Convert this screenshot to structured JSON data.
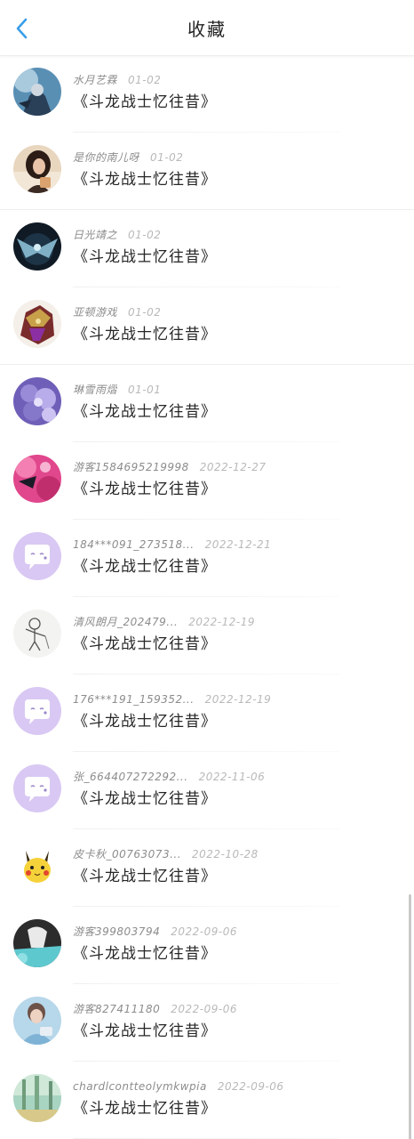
{
  "header": {
    "title": "收藏",
    "back_icon": "chevron-left-icon",
    "accent_color": "#3a9ee8"
  },
  "items": [
    {
      "username": "水月艺霖",
      "date": "01-02",
      "title": "《斗龙战士忆往昔》",
      "avatar": "photo"
    },
    {
      "username": "是你的南儿呀",
      "date": "01-02",
      "title": "《斗龙战士忆往昔》",
      "avatar": "photo"
    },
    {
      "username": "日光靖之",
      "date": "01-02",
      "title": "《斗龙战士忆往昔》",
      "avatar": "photo"
    },
    {
      "username": "亚顿游戏",
      "date": "01-02",
      "title": "《斗龙战士忆往昔》",
      "avatar": "photo"
    },
    {
      "username": "琳雪雨熠",
      "date": "01-01",
      "title": "《斗龙战士忆往昔》",
      "avatar": "photo"
    },
    {
      "username": "游客1584695219998",
      "date": "2022-12-27",
      "title": "《斗龙战士忆往昔》",
      "avatar": "photo"
    },
    {
      "username": "184***091_273518...",
      "date": "2022-12-21",
      "title": "《斗龙战士忆往昔》",
      "avatar": "default-chat-bubble"
    },
    {
      "username": "清风朗月_202479...",
      "date": "2022-12-19",
      "title": "《斗龙战士忆往昔》",
      "avatar": "sketch"
    },
    {
      "username": "176***191_159352...",
      "date": "2022-12-19",
      "title": "《斗龙战士忆往昔》",
      "avatar": "default-chat-bubble"
    },
    {
      "username": "张_664407272292...",
      "date": "2022-11-06",
      "title": "《斗龙战士忆往昔》",
      "avatar": "default-chat-bubble"
    },
    {
      "username": "皮卡秋_00763073...",
      "date": "2022-10-28",
      "title": "《斗龙战士忆往昔》",
      "avatar": "pikachu"
    },
    {
      "username": "游客399803794",
      "date": "2022-09-06",
      "title": "《斗龙战士忆往昔》",
      "avatar": "photo"
    },
    {
      "username": "游客827411180",
      "date": "2022-09-06",
      "title": "《斗龙战士忆往昔》",
      "avatar": "photo"
    },
    {
      "username": "chardlcontteolymkwpia",
      "date": "2022-09-06",
      "title": "《斗龙战士忆往昔》",
      "avatar": "photo"
    }
  ]
}
